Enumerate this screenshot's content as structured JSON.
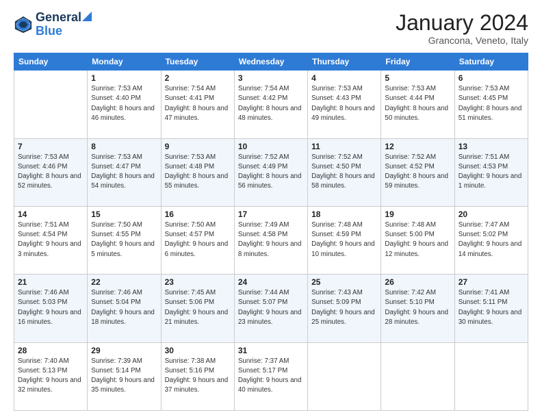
{
  "header": {
    "logo_line1": "General",
    "logo_line2": "Blue",
    "month": "January 2024",
    "location": "Grancona, Veneto, Italy"
  },
  "weekdays": [
    "Sunday",
    "Monday",
    "Tuesday",
    "Wednesday",
    "Thursday",
    "Friday",
    "Saturday"
  ],
  "weeks": [
    [
      {
        "day": "",
        "sunrise": "",
        "sunset": "",
        "daylight": ""
      },
      {
        "day": "1",
        "sunrise": "Sunrise: 7:53 AM",
        "sunset": "Sunset: 4:40 PM",
        "daylight": "Daylight: 8 hours and 46 minutes."
      },
      {
        "day": "2",
        "sunrise": "Sunrise: 7:54 AM",
        "sunset": "Sunset: 4:41 PM",
        "daylight": "Daylight: 8 hours and 47 minutes."
      },
      {
        "day": "3",
        "sunrise": "Sunrise: 7:54 AM",
        "sunset": "Sunset: 4:42 PM",
        "daylight": "Daylight: 8 hours and 48 minutes."
      },
      {
        "day": "4",
        "sunrise": "Sunrise: 7:53 AM",
        "sunset": "Sunset: 4:43 PM",
        "daylight": "Daylight: 8 hours and 49 minutes."
      },
      {
        "day": "5",
        "sunrise": "Sunrise: 7:53 AM",
        "sunset": "Sunset: 4:44 PM",
        "daylight": "Daylight: 8 hours and 50 minutes."
      },
      {
        "day": "6",
        "sunrise": "Sunrise: 7:53 AM",
        "sunset": "Sunset: 4:45 PM",
        "daylight": "Daylight: 8 hours and 51 minutes."
      }
    ],
    [
      {
        "day": "7",
        "sunrise": "Sunrise: 7:53 AM",
        "sunset": "Sunset: 4:46 PM",
        "daylight": "Daylight: 8 hours and 52 minutes."
      },
      {
        "day": "8",
        "sunrise": "Sunrise: 7:53 AM",
        "sunset": "Sunset: 4:47 PM",
        "daylight": "Daylight: 8 hours and 54 minutes."
      },
      {
        "day": "9",
        "sunrise": "Sunrise: 7:53 AM",
        "sunset": "Sunset: 4:48 PM",
        "daylight": "Daylight: 8 hours and 55 minutes."
      },
      {
        "day": "10",
        "sunrise": "Sunrise: 7:52 AM",
        "sunset": "Sunset: 4:49 PM",
        "daylight": "Daylight: 8 hours and 56 minutes."
      },
      {
        "day": "11",
        "sunrise": "Sunrise: 7:52 AM",
        "sunset": "Sunset: 4:50 PM",
        "daylight": "Daylight: 8 hours and 58 minutes."
      },
      {
        "day": "12",
        "sunrise": "Sunrise: 7:52 AM",
        "sunset": "Sunset: 4:52 PM",
        "daylight": "Daylight: 8 hours and 59 minutes."
      },
      {
        "day": "13",
        "sunrise": "Sunrise: 7:51 AM",
        "sunset": "Sunset: 4:53 PM",
        "daylight": "Daylight: 9 hours and 1 minute."
      }
    ],
    [
      {
        "day": "14",
        "sunrise": "Sunrise: 7:51 AM",
        "sunset": "Sunset: 4:54 PM",
        "daylight": "Daylight: 9 hours and 3 minutes."
      },
      {
        "day": "15",
        "sunrise": "Sunrise: 7:50 AM",
        "sunset": "Sunset: 4:55 PM",
        "daylight": "Daylight: 9 hours and 5 minutes."
      },
      {
        "day": "16",
        "sunrise": "Sunrise: 7:50 AM",
        "sunset": "Sunset: 4:57 PM",
        "daylight": "Daylight: 9 hours and 6 minutes."
      },
      {
        "day": "17",
        "sunrise": "Sunrise: 7:49 AM",
        "sunset": "Sunset: 4:58 PM",
        "daylight": "Daylight: 9 hours and 8 minutes."
      },
      {
        "day": "18",
        "sunrise": "Sunrise: 7:48 AM",
        "sunset": "Sunset: 4:59 PM",
        "daylight": "Daylight: 9 hours and 10 minutes."
      },
      {
        "day": "19",
        "sunrise": "Sunrise: 7:48 AM",
        "sunset": "Sunset: 5:00 PM",
        "daylight": "Daylight: 9 hours and 12 minutes."
      },
      {
        "day": "20",
        "sunrise": "Sunrise: 7:47 AM",
        "sunset": "Sunset: 5:02 PM",
        "daylight": "Daylight: 9 hours and 14 minutes."
      }
    ],
    [
      {
        "day": "21",
        "sunrise": "Sunrise: 7:46 AM",
        "sunset": "Sunset: 5:03 PM",
        "daylight": "Daylight: 9 hours and 16 minutes."
      },
      {
        "day": "22",
        "sunrise": "Sunrise: 7:46 AM",
        "sunset": "Sunset: 5:04 PM",
        "daylight": "Daylight: 9 hours and 18 minutes."
      },
      {
        "day": "23",
        "sunrise": "Sunrise: 7:45 AM",
        "sunset": "Sunset: 5:06 PM",
        "daylight": "Daylight: 9 hours and 21 minutes."
      },
      {
        "day": "24",
        "sunrise": "Sunrise: 7:44 AM",
        "sunset": "Sunset: 5:07 PM",
        "daylight": "Daylight: 9 hours and 23 minutes."
      },
      {
        "day": "25",
        "sunrise": "Sunrise: 7:43 AM",
        "sunset": "Sunset: 5:09 PM",
        "daylight": "Daylight: 9 hours and 25 minutes."
      },
      {
        "day": "26",
        "sunrise": "Sunrise: 7:42 AM",
        "sunset": "Sunset: 5:10 PM",
        "daylight": "Daylight: 9 hours and 28 minutes."
      },
      {
        "day": "27",
        "sunrise": "Sunrise: 7:41 AM",
        "sunset": "Sunset: 5:11 PM",
        "daylight": "Daylight: 9 hours and 30 minutes."
      }
    ],
    [
      {
        "day": "28",
        "sunrise": "Sunrise: 7:40 AM",
        "sunset": "Sunset: 5:13 PM",
        "daylight": "Daylight: 9 hours and 32 minutes."
      },
      {
        "day": "29",
        "sunrise": "Sunrise: 7:39 AM",
        "sunset": "Sunset: 5:14 PM",
        "daylight": "Daylight: 9 hours and 35 minutes."
      },
      {
        "day": "30",
        "sunrise": "Sunrise: 7:38 AM",
        "sunset": "Sunset: 5:16 PM",
        "daylight": "Daylight: 9 hours and 37 minutes."
      },
      {
        "day": "31",
        "sunrise": "Sunrise: 7:37 AM",
        "sunset": "Sunset: 5:17 PM",
        "daylight": "Daylight: 9 hours and 40 minutes."
      },
      {
        "day": "",
        "sunrise": "",
        "sunset": "",
        "daylight": ""
      },
      {
        "day": "",
        "sunrise": "",
        "sunset": "",
        "daylight": ""
      },
      {
        "day": "",
        "sunrise": "",
        "sunset": "",
        "daylight": ""
      }
    ]
  ]
}
